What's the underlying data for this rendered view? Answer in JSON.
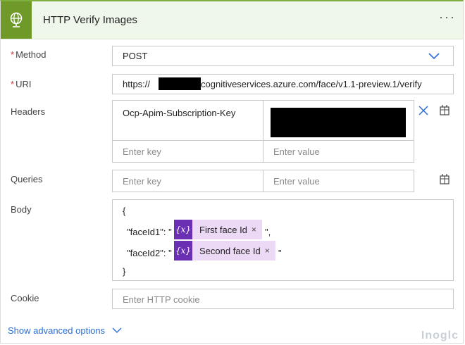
{
  "header": {
    "title": "HTTP Verify Images",
    "more": "···"
  },
  "method": {
    "label": "Method",
    "required_mark": "*",
    "value": "POST"
  },
  "uri": {
    "label": "URI",
    "required_mark": "*",
    "prefix": "https://",
    "suffix": "cognitiveservices.azure.com/face/v1.1-preview.1/verify"
  },
  "headers": {
    "label": "Headers",
    "key": "Ocp-Apim-Subscription-Key",
    "key_placeholder": "Enter key",
    "value_placeholder": "Enter value"
  },
  "queries": {
    "label": "Queries",
    "key_placeholder": "Enter key",
    "value_placeholder": "Enter value"
  },
  "body": {
    "label": "Body",
    "open": "{",
    "close": "}",
    "line1_key": "\"faceId1\": \"",
    "line1_end": "\",",
    "line2_key": "\"faceId2\": \"",
    "line2_end": "\"",
    "token_icon": "{x}",
    "token1": "First face Id",
    "token2": "Second face Id",
    "token_remove": "×"
  },
  "cookie": {
    "label": "Cookie",
    "placeholder": "Enter HTTP cookie"
  },
  "advanced": {
    "label": "Show advanced options"
  },
  "watermark": "Inoglc"
}
